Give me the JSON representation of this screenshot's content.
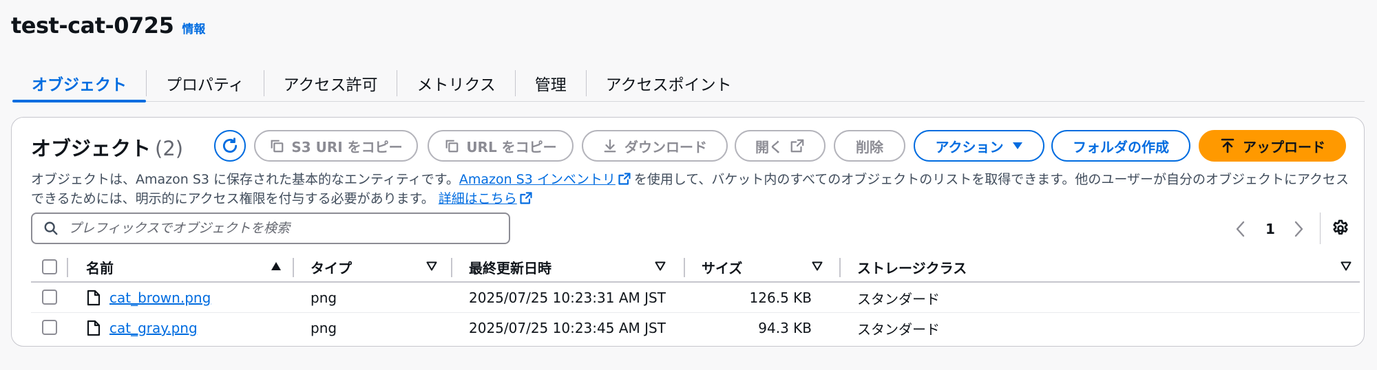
{
  "header": {
    "title": "test-cat-0725",
    "info": "情報"
  },
  "tabs": [
    {
      "label": "オブジェクト",
      "active": true
    },
    {
      "label": "プロパティ"
    },
    {
      "label": "アクセス許可"
    },
    {
      "label": "メトリクス"
    },
    {
      "label": "管理"
    },
    {
      "label": "アクセスポイント"
    }
  ],
  "panel": {
    "title": "オブジェクト",
    "count": "(2)",
    "buttons": {
      "copy_s3_uri": "S3 URI をコピー",
      "copy_url": "URL をコピー",
      "download": "ダウンロード",
      "open": "開く",
      "delete": "削除",
      "actions": "アクション",
      "create_folder": "フォルダの作成",
      "upload": "アップロード"
    },
    "description": {
      "part1": "オブジェクトは、Amazon S3 に保存された基本的なエンティティです。",
      "inventory_link": "Amazon S3 インベントリ",
      "part2": "を使用して、バケット内のすべてのオブジェクトのリストを取得できます。他のユーザーが自分のオブジェクトにアクセスできるためには、明示的にアクセス権限を付与する必要があります。",
      "learn_more": "詳細はこちら"
    },
    "search": {
      "placeholder": "プレフィックスでオブジェクトを検索",
      "value": ""
    },
    "pagination": {
      "current_page": "1"
    }
  },
  "table": {
    "columns": {
      "name": "名前",
      "type": "タイプ",
      "last_modified": "最終更新日時",
      "size": "サイズ",
      "storage_class": "ストレージクラス"
    },
    "rows": [
      {
        "name": "cat_brown.png",
        "type": "png",
        "last_modified": "2025/07/25 10:23:31 AM JST",
        "size": "126.5 KB",
        "storage_class": "スタンダード"
      },
      {
        "name": "cat_gray.png",
        "type": "png",
        "last_modified": "2025/07/25 10:23:45 AM JST",
        "size": "94.3 KB",
        "storage_class": "スタンダード"
      }
    ]
  },
  "colors": {
    "link": "#006ce0",
    "primary_button": "#ff9900",
    "disabled": "#8c8c94",
    "text": "#0f141a",
    "border": "#c6c6cd"
  },
  "icons": {
    "refresh": "refresh-icon",
    "copy": "copy-icon",
    "download": "download-icon",
    "external": "external-link-icon",
    "caret": "caret-down-icon",
    "upload": "upload-icon",
    "search": "search-icon",
    "file": "file-icon",
    "settings": "settings-gear-icon"
  }
}
